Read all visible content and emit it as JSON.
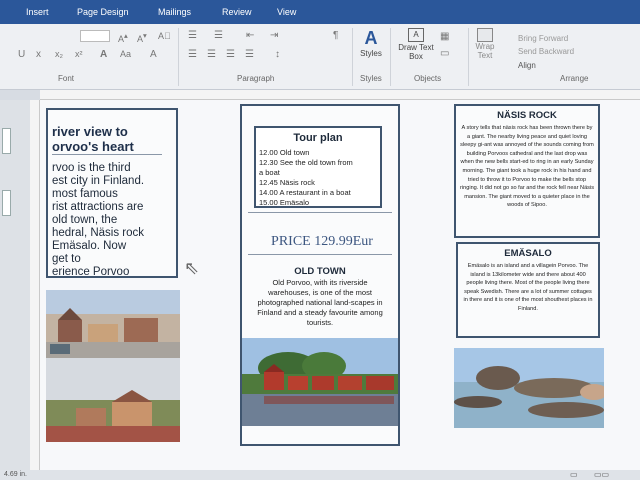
{
  "ribbon": {
    "tabs": [
      "Insert",
      "Page Design",
      "Mailings",
      "Review",
      "View"
    ],
    "groups": {
      "font": "Font",
      "paragraph": "Paragraph",
      "styles": "Styles",
      "objects": "Objects",
      "arrange": "Arrange"
    },
    "buttons": {
      "styles": "Styles",
      "draw_text_box": "Draw Text Box",
      "wrap_text": "Wrap Text",
      "bring_forward": "Bring Forward",
      "send_backward": "Send Backward",
      "align": "Align"
    }
  },
  "status": {
    "position": "4.69 in."
  },
  "brochure": {
    "headline": "river view to\norvoo's heart",
    "intro": "rvoo is the third\nest city in Finland.\nmost famous\nrist attractions are\nold town, the\nhedral, Näsis rock\nEmäsalo. Now\nget to\nerience Porvoo",
    "tour": {
      "title": "Tour plan",
      "items": [
        "12.00 Old town",
        "12.30 See the old town from",
        "a boat",
        "12.45 Näsis rock",
        "14.00 A restaurant in a boat",
        "15.00 Emäsalo"
      ]
    },
    "price": "PRICE 129.99Eur",
    "old_town": {
      "title": "OLD TOWN",
      "text": "Old Porvoo, with its riverside warehouses, is one of the most photographed national land-scapes in Finland and a steady favourite among tourists."
    },
    "nasis": {
      "title": "NÄSIS ROCK",
      "text": "A story tells that näsis rock has been thrown there by a giant. The nearby living peace and quiet loving sleepy gi-ant was annoyed of the sounds coming from building Porvoos cathedral and the last drop was when the new bells start-ed to ring in an early Sunday morning. The giant took a huge rock in his hand and tried to throw it to Porvoo to make the bells stop ringing. It did not go so far and the rock fell near Näsis mansion. The giant moved to a quieter place in the woods of Sipoo."
    },
    "emasalo": {
      "title": "EMÄSALO",
      "text": "Emäsalo is an island and a villagein Porvoo. The island is 13kilometer wide and there about 400 people living there. Most of the people living there speak Swedish. There are a lot of summer cottages in there and it is one of the most shouthest places in Finland."
    }
  }
}
